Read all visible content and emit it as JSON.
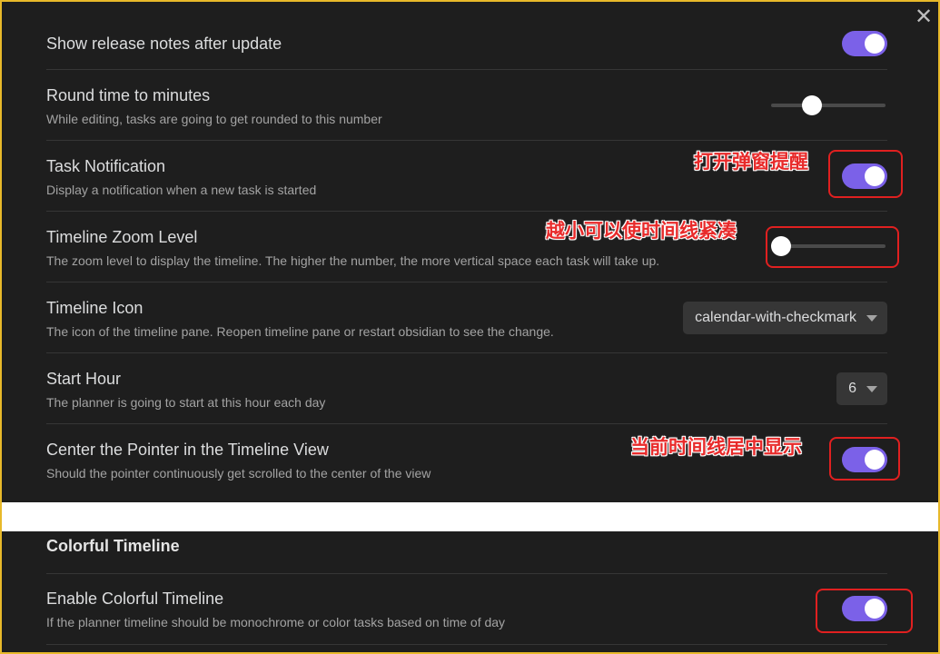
{
  "colors": {
    "panel_bg": "#1e1e1e",
    "accent": "#7b61e8",
    "annotation": "#e02020"
  },
  "close_label": "✕",
  "settings": [
    {
      "name": "Show release notes after update",
      "desc": "",
      "control": "toggle",
      "value": true
    },
    {
      "name": "Round time to minutes",
      "desc": "While editing, tasks are going to get rounded to this number",
      "control": "slider",
      "value_fraction": 0.36
    },
    {
      "name": "Task Notification",
      "desc": "Display a notification when a new task is started",
      "control": "toggle",
      "value": true
    },
    {
      "name": "Timeline Zoom Level",
      "desc": "The zoom level to display the timeline. The higher the number, the more vertical space each task will take up.",
      "control": "slider",
      "value_fraction": 0.09
    },
    {
      "name": "Timeline Icon",
      "desc": "The icon of the timeline pane. Reopen timeline pane or restart obsidian to see the change.",
      "control": "dropdown",
      "value": "calendar-with-checkmark"
    },
    {
      "name": "Start Hour",
      "desc": "The planner is going to start at this hour each day",
      "control": "dropdown",
      "value": "6"
    },
    {
      "name": "Center the Pointer in the Timeline View",
      "desc": "Should the pointer continuously get scrolled to the center of the view",
      "control": "toggle",
      "value": true
    }
  ],
  "section": {
    "title": "Colorful Timeline",
    "settings": [
      {
        "name": "Enable Colorful Timeline",
        "desc": "If the planner timeline should be monochrome or color tasks based on time of day",
        "control": "toggle",
        "value": true
      }
    ]
  },
  "annotations": {
    "notification": "打开弹窗提醒",
    "zoom": "越小可以使时间线紧凑",
    "center": "当前时间线居中显示"
  }
}
